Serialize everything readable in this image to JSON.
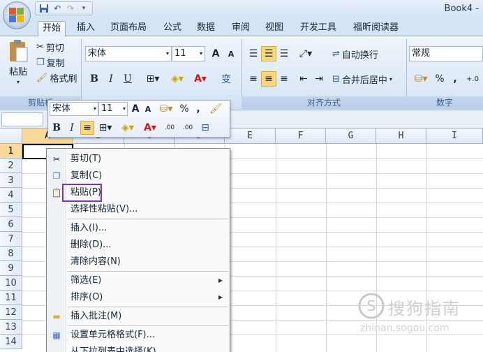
{
  "window": {
    "title": "Book4 -"
  },
  "qat": {
    "icons": [
      "save-icon",
      "undo-icon",
      "redo-icon",
      "customize-icon"
    ]
  },
  "tabs": [
    "开始",
    "插入",
    "页面布局",
    "公式",
    "数据",
    "审阅",
    "视图",
    "开发工具",
    "福昕阅读器"
  ],
  "ribbon": {
    "clipboard": {
      "paste": "粘贴",
      "cut": "剪切",
      "copy": "复制",
      "format_painter": "格式刷",
      "group": "剪贴板"
    },
    "font": {
      "name": "宋体",
      "size": "11",
      "bold": "B",
      "italic": "I",
      "underline": "U",
      "grow": "A",
      "shrink": "A",
      "phonetic": "变"
    },
    "alignment": {
      "wrap": "自动换行",
      "merge": "合并后居中",
      "group": "对齐方式"
    },
    "number": {
      "format": "常规",
      "percent": "%",
      "comma": ",",
      "group": "数字"
    }
  },
  "mini_toolbar": {
    "font": "宋体",
    "size": "11",
    "percent": "%",
    "comma": ",",
    "bold": "B",
    "italic": "I",
    "dec_inc": ".00",
    "dec_dec": ".00"
  },
  "grid": {
    "columns": [
      "A",
      "B",
      "C",
      "D",
      "E",
      "F",
      "G",
      "H",
      "I"
    ],
    "rows": [
      "1",
      "2",
      "3",
      "4",
      "5",
      "6",
      "7",
      "8",
      "9",
      "10",
      "11",
      "12",
      "13",
      "14"
    ]
  },
  "context_menu": {
    "items": [
      {
        "label": "剪切(T)",
        "icon": "scissors-icon"
      },
      {
        "label": "复制(C)",
        "icon": "copy-icon"
      },
      {
        "label": "粘贴(P)",
        "icon": "paste-icon"
      },
      {
        "label": "选择性粘贴(V)..."
      },
      {
        "label": "插入(I)..."
      },
      {
        "label": "删除(D)..."
      },
      {
        "label": "清除内容(N)"
      },
      {
        "label": "筛选(E)",
        "submenu": true
      },
      {
        "label": "排序(O)",
        "submenu": true
      },
      {
        "label": "插入批注(M)",
        "icon": "comment-icon"
      },
      {
        "label": "设置单元格格式(F)...",
        "icon": "format-cells-icon"
      },
      {
        "label": "从下拉列表中选择(K)..."
      }
    ]
  },
  "watermark": {
    "text": "搜狗指南",
    "url": "zhinan.sogou.com"
  },
  "colors": {
    "accent": "#7b34b8",
    "selection": "#f9d99a",
    "ribbon": "#dde9f7"
  }
}
